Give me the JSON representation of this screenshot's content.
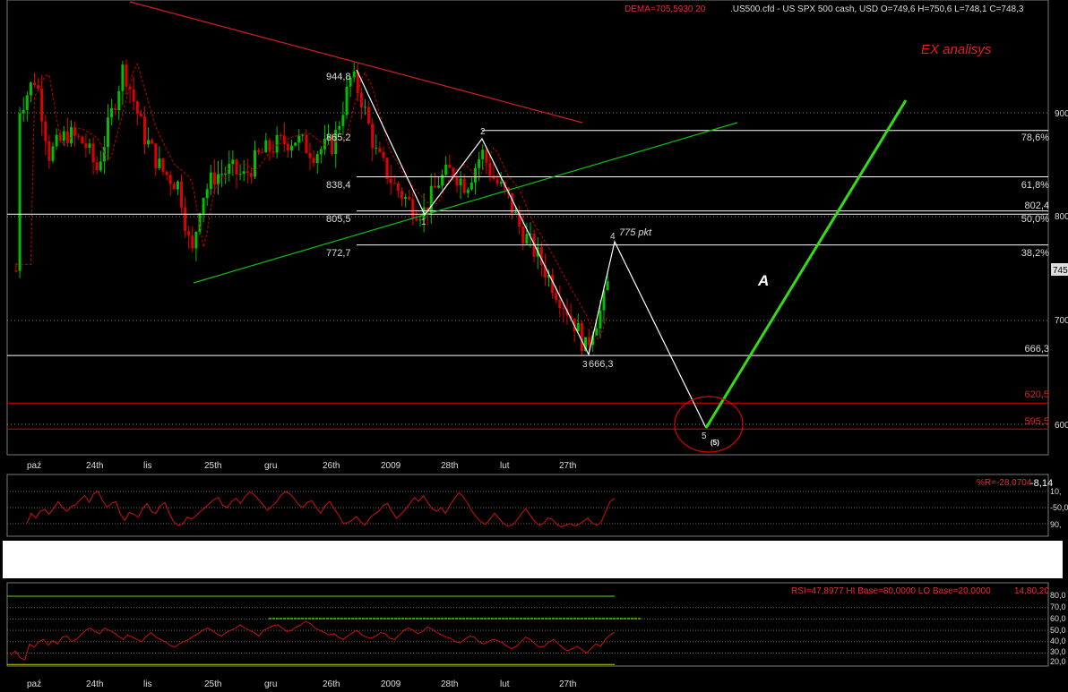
{
  "header": {
    "dema_label": "DEMA=705,5930  20",
    "symbol_label": ".US500.cfd - US SPX 500 cash, USD O=749,6 H=750,6 L=748,1 C=748,3",
    "analysis_title": "EX analisys"
  },
  "colors": {
    "background": "#000000",
    "bull_candle": "#00c000",
    "bear_candle": "#e00000",
    "dema_line": "#c00000",
    "resistance_line": "#d02020",
    "support_line": "#10c010",
    "wave_line": "#ffffff",
    "projection_line": "#33dd11",
    "fib_line": "#ffffff",
    "target_line": "#e00000",
    "indicator_line": "#d01010",
    "rsi_hi_base": "#66dd00",
    "rsi_lo_base": "#cccc00"
  },
  "chart_data": [
    {
      "type": "candlestick",
      "price_axis": {
        "ylim": [
          570,
          1010
        ],
        "labels": [
          "900",
          "800",
          "745",
          "700",
          "600"
        ]
      },
      "time_axis": {
        "labels": [
          "paź",
          "24th",
          "lis",
          "25th",
          "gru",
          "26th",
          "2009",
          "28th",
          "lut",
          "27th"
        ]
      },
      "wave_points": [
        {
          "label": "944,8",
          "value": 944.8
        },
        {
          "label": "1",
          "value": 805.5
        },
        {
          "label": "2",
          "value": 865.2
        },
        {
          "label": "3",
          "value": 666.3
        },
        {
          "label": "4",
          "value": 775
        },
        {
          "label": "5",
          "value": 597
        }
      ],
      "wave_labels": {
        "top": "944,8",
        "w1": "1",
        "w2": "2",
        "w3": "3",
        "w3_value": "666,3",
        "w4": "4",
        "w4_note": "775 pkt",
        "w5": "5",
        "w5_degree": "(5)"
      },
      "left_levels": [
        "865,2",
        "838,4",
        "805,5",
        "772,7"
      ],
      "fibonacci": [
        {
          "ratio": "78,6%",
          "value": 883
        },
        {
          "ratio": "61,8%",
          "value": 838.4
        },
        {
          "ratio": "50,0%",
          "value": 805.5
        },
        {
          "ratio": "38,2%",
          "value": 772.7
        }
      ],
      "horizontal_levels": [
        {
          "label": "802,4",
          "value": 802.4,
          "color": "white"
        },
        {
          "label": "666,3",
          "value": 666.3,
          "color": "white"
        },
        {
          "label": "620,5",
          "value": 620.5,
          "color": "red"
        },
        {
          "label": "595,5",
          "value": 595.5,
          "color": "red"
        }
      ],
      "current_price_tag": "745",
      "projection_label": "A",
      "dema": {
        "period": 20,
        "value": 705.593
      }
    },
    {
      "type": "line",
      "name": "%R",
      "indicator_label": "%R=-28,0704",
      "overlay_value": "-8,14",
      "ylim": [
        -100,
        0
      ],
      "tick_labels": [
        "10,",
        "-50,0",
        "90,"
      ],
      "values": [
        -85,
        -60,
        -72,
        -55,
        -50,
        -62,
        -48,
        -30,
        -45,
        -55,
        -42,
        -38,
        -25,
        -15,
        -32,
        -10,
        -4,
        -28,
        -45,
        -35,
        -30,
        -62,
        -78,
        -58,
        -62,
        -70,
        -48,
        -35,
        -56,
        -60,
        -40,
        -33,
        -60,
        -82,
        -90,
        -88,
        -70,
        -75,
        -66,
        -55,
        -46,
        -35,
        -25,
        -20,
        -40,
        -46,
        -30,
        -22,
        -35,
        -18,
        -6,
        -12,
        -25,
        -38,
        -52,
        -42,
        -32,
        -15,
        -5,
        -10,
        -22,
        -38,
        -45,
        -32,
        -28,
        -46,
        -60,
        -40,
        -30,
        -48,
        -64,
        -85,
        -84,
        -78,
        -68,
        -82,
        -90,
        -72,
        -62,
        -55,
        -40,
        -35,
        -55,
        -73,
        -62,
        -50,
        -35,
        -20,
        -30,
        -15,
        -32,
        -48,
        -55,
        -45,
        -60,
        -40,
        -22,
        -8,
        -18,
        -35,
        -55,
        -70,
        -82,
        -88,
        -75,
        -60,
        -72,
        -85,
        -92,
        -90,
        -78,
        -62,
        -48,
        -64,
        -80,
        -90,
        -86,
        -72,
        -75,
        -88,
        -94,
        -90,
        -86,
        -92,
        -88,
        -80,
        -72,
        -85,
        -90,
        -82,
        -55,
        -30,
        -22
      ]
    },
    {
      "type": "line",
      "name": "RSI",
      "indicator_label": "RSI=47,8977 HI Base=80,0000 LO Base=20,0000",
      "overlay_values": "14,80,20",
      "ylim": [
        15,
        85
      ],
      "tick_labels": [
        "80,0",
        "70,0",
        "60,0",
        "50,0",
        "40,0",
        "30,0",
        "20,0"
      ],
      "hi_base": 80,
      "lo_base": 20,
      "values": [
        28,
        32,
        26,
        24,
        38,
        35,
        40,
        42,
        37,
        41,
        38,
        44,
        45,
        40,
        42,
        46,
        50,
        52,
        49,
        47,
        52,
        50,
        48,
        45,
        42,
        46,
        44,
        42,
        40,
        45,
        48,
        44,
        42,
        40,
        37,
        35,
        38,
        40,
        42,
        45,
        47,
        50,
        52,
        50,
        47,
        45,
        48,
        50,
        52,
        55,
        52,
        50,
        48,
        45,
        50,
        52,
        54,
        55,
        52,
        49,
        50,
        53,
        55,
        58,
        56,
        52,
        50,
        48,
        46,
        47,
        44,
        42,
        45,
        48,
        50,
        46,
        44,
        43,
        45,
        48,
        47,
        43,
        42,
        46,
        50,
        52,
        50,
        47,
        49,
        53,
        51,
        48,
        46,
        44,
        43,
        40,
        39,
        42,
        45,
        44,
        40,
        38,
        40,
        42,
        41,
        39,
        36,
        34,
        36,
        40,
        44,
        42,
        38,
        35,
        36,
        40,
        42,
        38,
        34,
        32,
        34,
        36,
        33,
        30,
        34,
        38,
        36,
        42,
        46,
        48
      ]
    }
  ]
}
